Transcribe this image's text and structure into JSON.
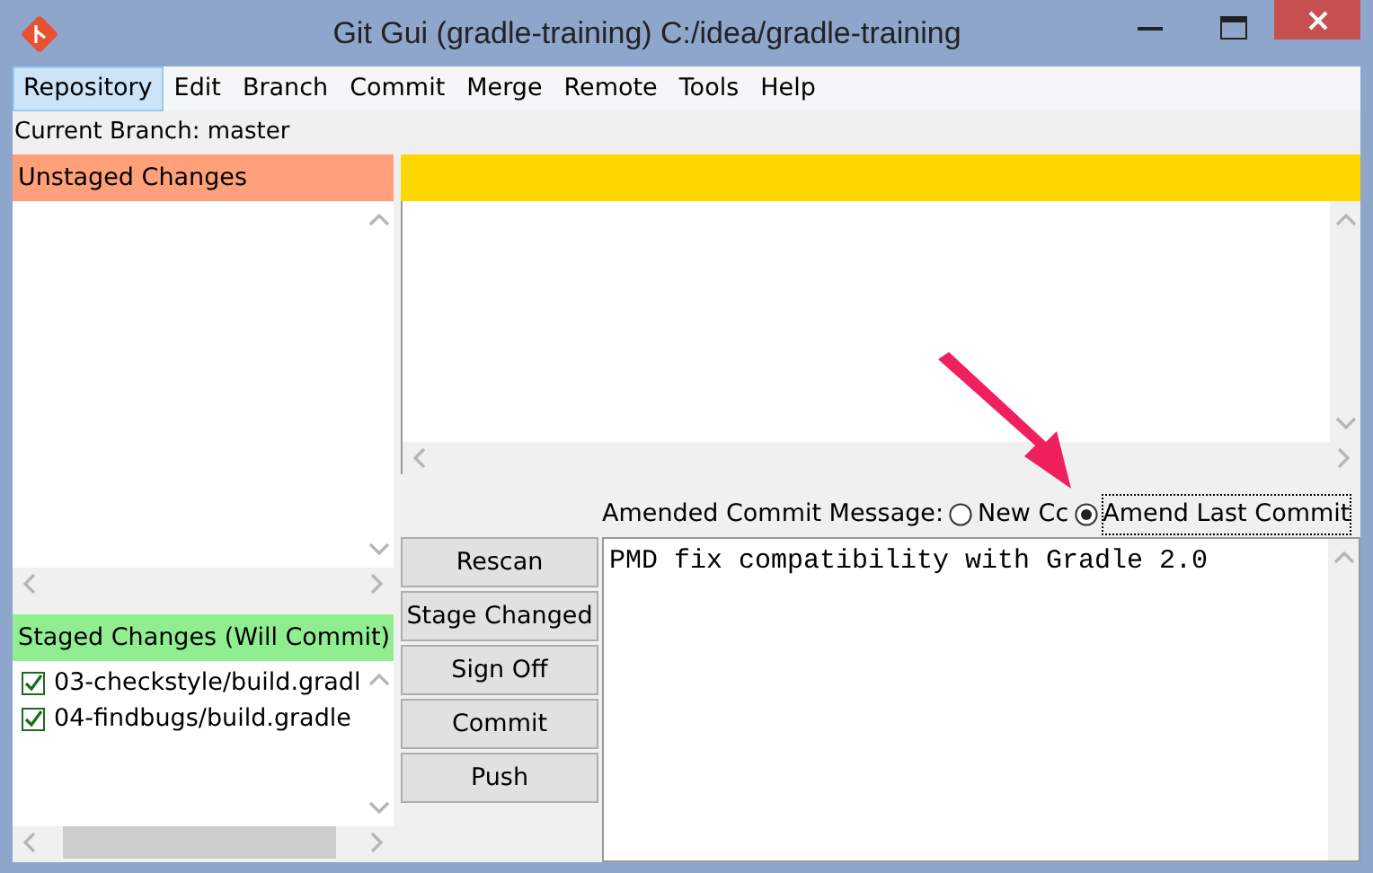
{
  "window": {
    "title": "Git Gui (gradle-training) C:/idea/gradle-training"
  },
  "menu": [
    {
      "label": "Repository",
      "selected": true
    },
    {
      "label": "Edit",
      "selected": false
    },
    {
      "label": "Branch",
      "selected": false
    },
    {
      "label": "Commit",
      "selected": false
    },
    {
      "label": "Merge",
      "selected": false
    },
    {
      "label": "Remote",
      "selected": false
    },
    {
      "label": "Tools",
      "selected": false
    },
    {
      "label": "Help",
      "selected": false
    }
  ],
  "current_branch": "Current Branch: master",
  "unstaged": {
    "title": "Unstaged Changes"
  },
  "staged": {
    "title": "Staged Changes (Will Commit)",
    "files": [
      {
        "name": "03-checkstyle/build.gradl",
        "checked": true
      },
      {
        "name": "04-findbugs/build.gradle",
        "checked": true
      }
    ]
  },
  "commit_message": {
    "label": "Amended Commit Message:",
    "options": [
      {
        "label": "New Cc",
        "selected": false
      },
      {
        "label": "Amend Last Commit",
        "selected": true
      }
    ],
    "text": "PMD fix compatibility with Gradle 2.0"
  },
  "buttons": [
    "Rescan",
    "Stage Changed",
    "Sign Off",
    "Commit",
    "Push"
  ]
}
